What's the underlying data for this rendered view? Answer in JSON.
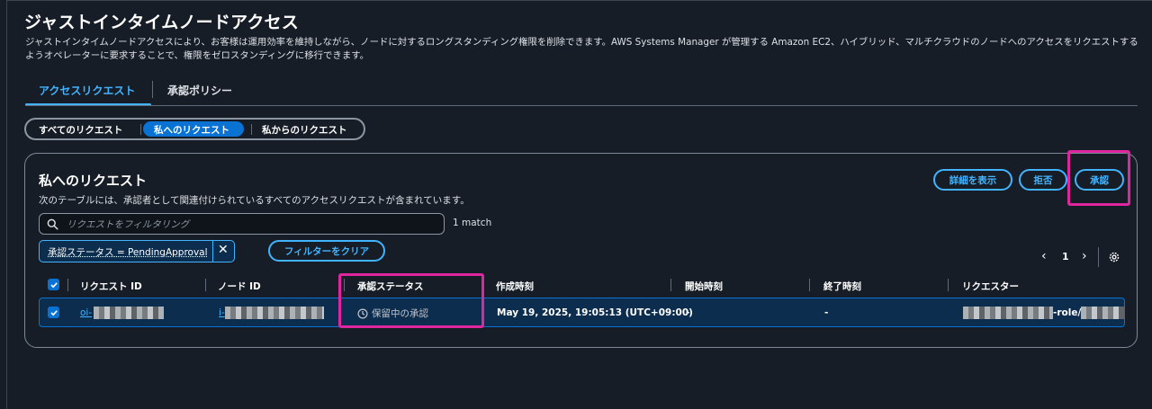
{
  "page": {
    "title": "ジャストインタイムノードアクセス",
    "description": "ジャストインタイムノードアクセスにより、お客様は運用効率を維持しながら、ノードに対するロングスタンディング権限を削除できます。AWS Systems Manager が管理する Amazon EC2、ハイブリッド、マルチクラウドのノードへのアクセスをリクエストするようオペレーターに要求することで、権限をゼロスタンディングに移行できます。"
  },
  "tabs": [
    {
      "label": "アクセスリクエスト",
      "active": true
    },
    {
      "label": "承認ポリシー",
      "active": false
    }
  ],
  "segments": [
    {
      "label": "すべてのリクエスト",
      "active": false
    },
    {
      "label": "私へのリクエスト",
      "active": true
    },
    {
      "label": "私からのリクエスト",
      "active": false
    }
  ],
  "panel": {
    "title": "私へのリクエスト",
    "description": "次のテーブルには、承認者として関連付けられているすべてのアクセスリクエストが含まれています。",
    "buttons": {
      "details": "詳細を表示",
      "reject": "拒否",
      "approve": "承認"
    },
    "search": {
      "placeholder": "リクエストをフィルタリング",
      "match_text": "1 match"
    },
    "filter_token": "承認ステータス = PendingApproval",
    "clear_filter": "フィルターをクリア",
    "pagination": {
      "current_page": "1"
    },
    "table": {
      "columns": [
        "リクエスト ID",
        "ノード ID",
        "承認ステータス",
        "作成時刻",
        "開始時刻",
        "終了時刻",
        "リクエスター"
      ],
      "rows": [
        {
          "selected": true,
          "request_id_prefix": "oi-",
          "node_id_prefix": "i-",
          "status": "保留中の承認",
          "created": "May 19, 2025, 19:05:13 (UTC+09:00)",
          "start": "-",
          "end": "-",
          "requester_fragment": "-role/"
        }
      ]
    }
  },
  "colors": {
    "background": "#161d26",
    "accent": "#42b4ff",
    "primary": "#0972d3",
    "highlight": "#e0269e"
  },
  "icons": [
    "search-icon",
    "close-icon",
    "chevron-left-icon",
    "chevron-right-icon",
    "gear-icon",
    "check-icon",
    "clock-icon"
  ]
}
